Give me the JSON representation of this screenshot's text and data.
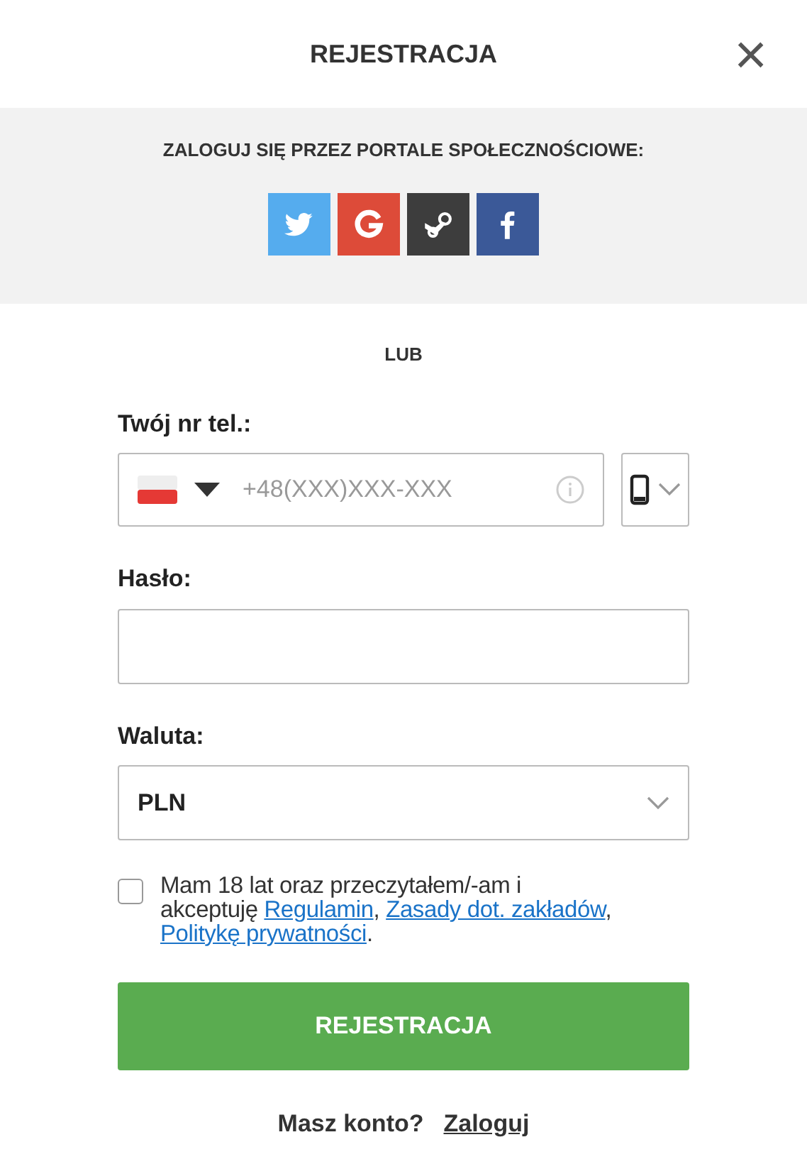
{
  "header": {
    "title": "REJESTRACJA",
    "close": "×"
  },
  "social": {
    "heading": "ZALOGUJ SIĘ PRZEZ PORTALE SPOŁECZNOŚCIOWE:",
    "buttons": [
      {
        "kind": "twitter",
        "color": "#55acee"
      },
      {
        "kind": "google",
        "color": "#dd4b39"
      },
      {
        "kind": "steam",
        "color": "#3d3d3d"
      },
      {
        "kind": "facebook",
        "color": "#3b5998"
      }
    ]
  },
  "separator": "LUB",
  "phone": {
    "label": "Twój nr tel.:",
    "placeholder": "+48(XXX)XXX-XXX"
  },
  "password": {
    "label": "Hasło:"
  },
  "currency": {
    "label": "Waluta:",
    "value": "PLN"
  },
  "consent": {
    "checked": false,
    "parts": [
      {
        "kind": "text",
        "text": "Mam 18 lat oraz przeczytałem/-am i akceptuję "
      },
      {
        "kind": "link",
        "text": "Regulamin"
      },
      {
        "kind": "text",
        "text": ", "
      },
      {
        "kind": "link",
        "text": "Zasady dot. zakładów"
      },
      {
        "kind": "text",
        "text": ", "
      },
      {
        "kind": "link",
        "text": "Politykę prywatności"
      },
      {
        "kind": "text",
        "text": "."
      }
    ]
  },
  "submit": "REJESTRACJA",
  "footer": {
    "question": "Masz konto?",
    "link": "Zaloguj"
  }
}
